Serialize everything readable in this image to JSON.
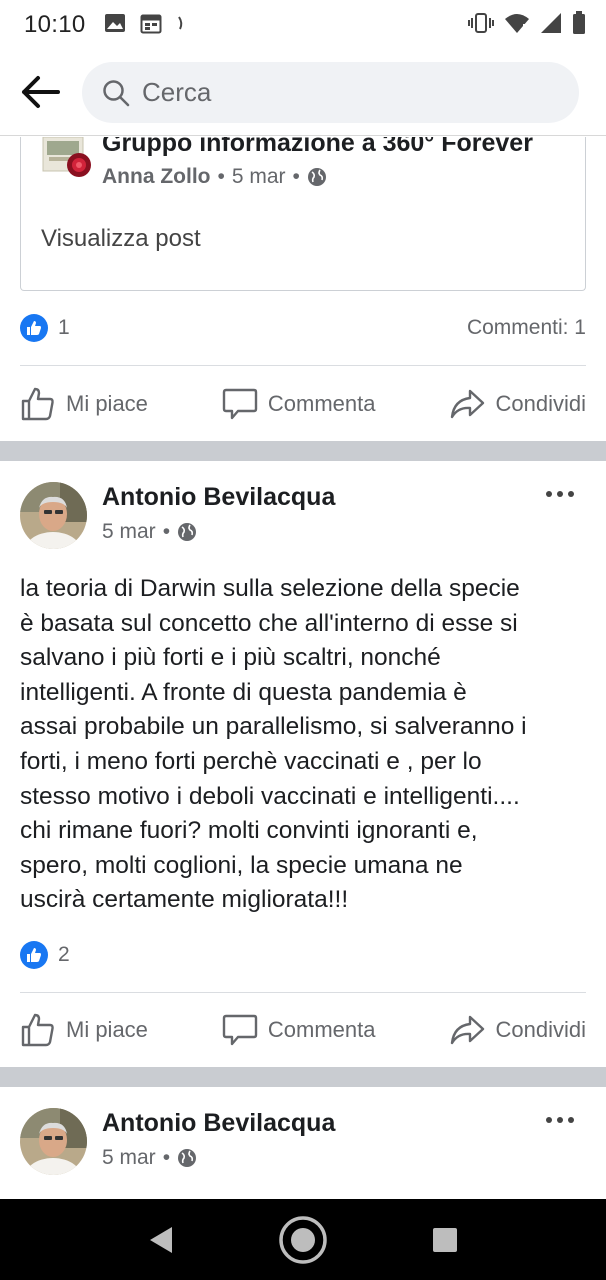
{
  "status_bar": {
    "time": "10:10",
    "icons": [
      "image-icon",
      "calendar-icon",
      "sync-icon",
      "vibrate-icon",
      "wifi-icon",
      "signal-icon",
      "battery-icon"
    ]
  },
  "search": {
    "placeholder": "Cerca"
  },
  "shared_post": {
    "group_name": "Gruppo informazione a 360° Forever",
    "author": "Anna Zollo",
    "separator": "•",
    "date": "5 mar",
    "view_post_label": "Visualizza post",
    "reaction_count": "1",
    "comments_label": "Commenti: 1"
  },
  "actions": {
    "like_label": "Mi piace",
    "comment_label": "Commenta",
    "share_label": "Condividi"
  },
  "post1": {
    "author": "Antonio Bevilacqua",
    "date": "5 mar",
    "separator": "•",
    "text": "la teoria di Darwin sulla selezione della specie\nè basata sul concetto che all'interno di esse si\nsalvano i più forti e i più scaltri, nonché\nintelligenti. A fronte di questa pandemia è\nassai probabile un parallelismo, si salveranno i\nforti, i meno forti perchè vaccinati e , per lo\nstesso motivo i deboli vaccinati e intelligenti....\nchi rimane fuori? molti convinti ignoranti e,\nspero, molti coglioni, la specie umana ne\nuscirà certamente migliorata!!!",
    "reaction_count": "2"
  },
  "post2": {
    "author": "Antonio Bevilacqua",
    "date": "5 mar",
    "separator": "•"
  },
  "colors": {
    "facebook_blue": "#1877f2",
    "secondary_text": "#65676b",
    "separator_gray": "#c9ccd1",
    "search_bg": "#f0f2f5"
  }
}
